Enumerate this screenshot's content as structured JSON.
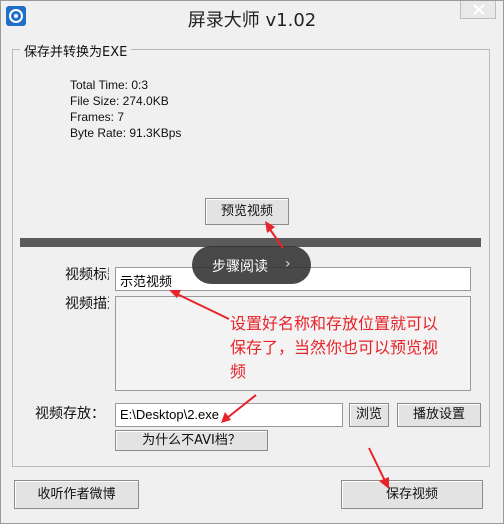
{
  "window": {
    "title": "屏录大师 v1.02"
  },
  "group": {
    "label": "保存并转换为EXE"
  },
  "info": {
    "total_time": "Total Time: 0:3",
    "file_size": "File Size: 274.0KB",
    "frames": "Frames: 7",
    "byte_rate": "Byte Rate: 91.3KBps"
  },
  "buttons": {
    "preview": "预览视频",
    "browse": "浏览",
    "playback_settings": "播放设置",
    "why_not_avi": "为什么不AVI档？",
    "follow_weibo": "收听作者微博",
    "save_video": "保存视频"
  },
  "overlay": {
    "step_read": "步骤阅读"
  },
  "form": {
    "title_label": "视频标题",
    "title_value": "示范视频",
    "desc_label": "视频描述",
    "location_label": "视频存放：",
    "location_value": "E:\\Desktop\\2.exe"
  },
  "annotation": {
    "text": "设置好名称和存放位置就可以保存了，当然你也可以预览视频"
  },
  "colors": {
    "annotation_red": "#e8232a",
    "divider": "#5a5a5a",
    "pill_bg": "#303030"
  }
}
